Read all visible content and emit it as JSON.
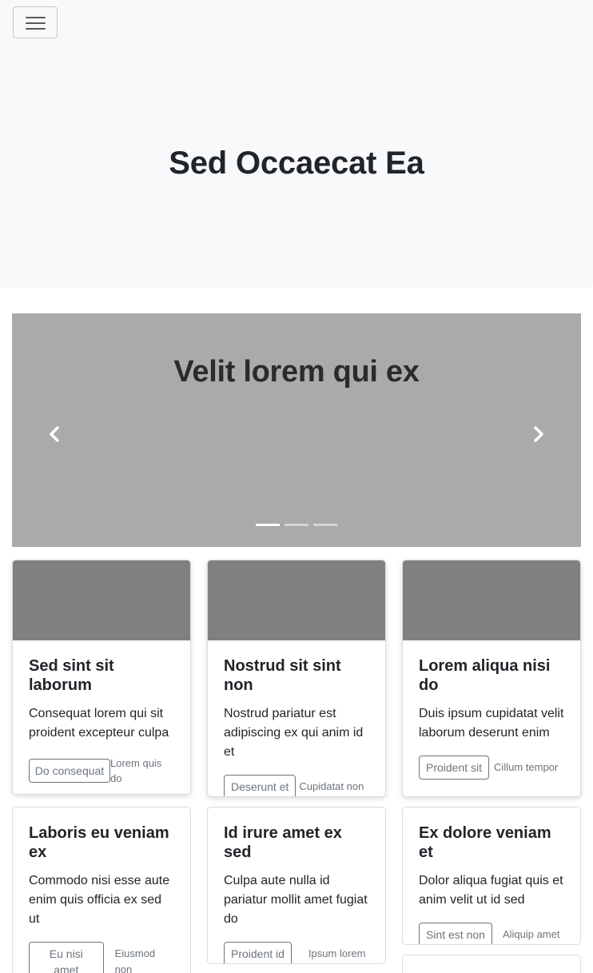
{
  "navbar": {
    "toggler_icon": "hamburger-icon"
  },
  "hero": {
    "title": "Sed Occaecat Ea"
  },
  "carousel": {
    "caption": "Velit lorem qui ex",
    "prev_icon": "chevron-left-icon",
    "next_icon": "chevron-right-icon",
    "slide_count": 3,
    "active_slide": 1
  },
  "cards": [
    {
      "title": "Sed sint sit laborum",
      "text": "Consequat lorem qui sit proident excepteur culpa",
      "button": "Do consequat",
      "note": "Lorem quis do",
      "has_image": true
    },
    {
      "title": "Nostrud sit sint non",
      "text": "Nostrud pariatur est adipiscing ex qui anim id et",
      "button": "Deserunt et",
      "note": "Cupidatat non",
      "has_image": true
    },
    {
      "title": "Lorem aliqua nisi do",
      "text": "Duis ipsum cupidatat velit laborum deserunt enim",
      "button": "Proident sit",
      "note": "Cillum tempor",
      "has_image": true
    },
    {
      "title": "Laboris eu veniam ex",
      "text": "Commodo nisi esse aute enim quis officia ex sed ut",
      "button": "Eu nisi amet",
      "note": "Eiusmod non",
      "has_image": false
    },
    {
      "title": "Id irure amet ex sed",
      "text": "Culpa aute nulla id pariatur mollit amet fugiat do",
      "button": "Proident id",
      "note": "Ipsum lorem",
      "has_image": false
    },
    {
      "title": "Ex dolore veniam et",
      "text": "Dolor aliqua fugiat quis et anim velit ut id sed",
      "button": "Sint est non",
      "note": "Aliquip amet",
      "has_image": false
    }
  ],
  "colors": {
    "placeholder_image": "#808080",
    "carousel_bg": "#aaaaaa",
    "muted_text": "#6c757d",
    "light_bg": "#f8f9fa"
  }
}
